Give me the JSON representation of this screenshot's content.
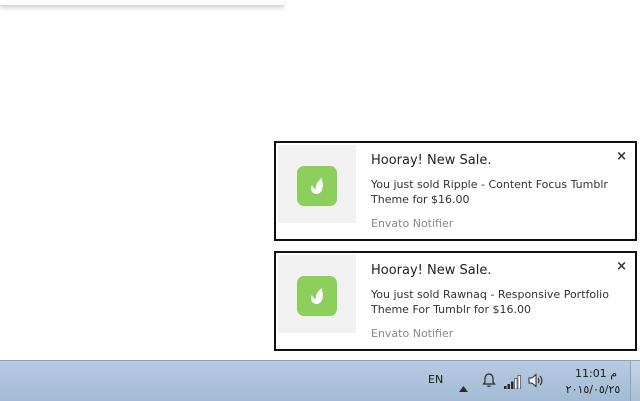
{
  "notifications": [
    {
      "title": "Hooray! New Sale.",
      "message": "You just sold Ripple - Content Focus Tumblr Theme for $16.00",
      "source": "Envato Notifier",
      "close": "×"
    },
    {
      "title": "Hooray! New Sale.",
      "message": "You just sold Rawnaq - Responsive Portfolio Theme For Tumblr for $16.00",
      "source": "Envato Notifier",
      "close": "×"
    }
  ],
  "taskbar": {
    "language": "EN",
    "time": "11:01 م",
    "date": "٢٠١٥/٠٥/٢٥"
  },
  "colors": {
    "app_icon_green": "#8ccf5d",
    "taskbar_blue": "#a3bbd6"
  },
  "icons": {
    "app": "envato-leaf-icon",
    "close": "close-icon",
    "tray": [
      "tray-up-arrow-icon",
      "bell-icon",
      "signal-bars-icon",
      "speaker-icon"
    ]
  }
}
